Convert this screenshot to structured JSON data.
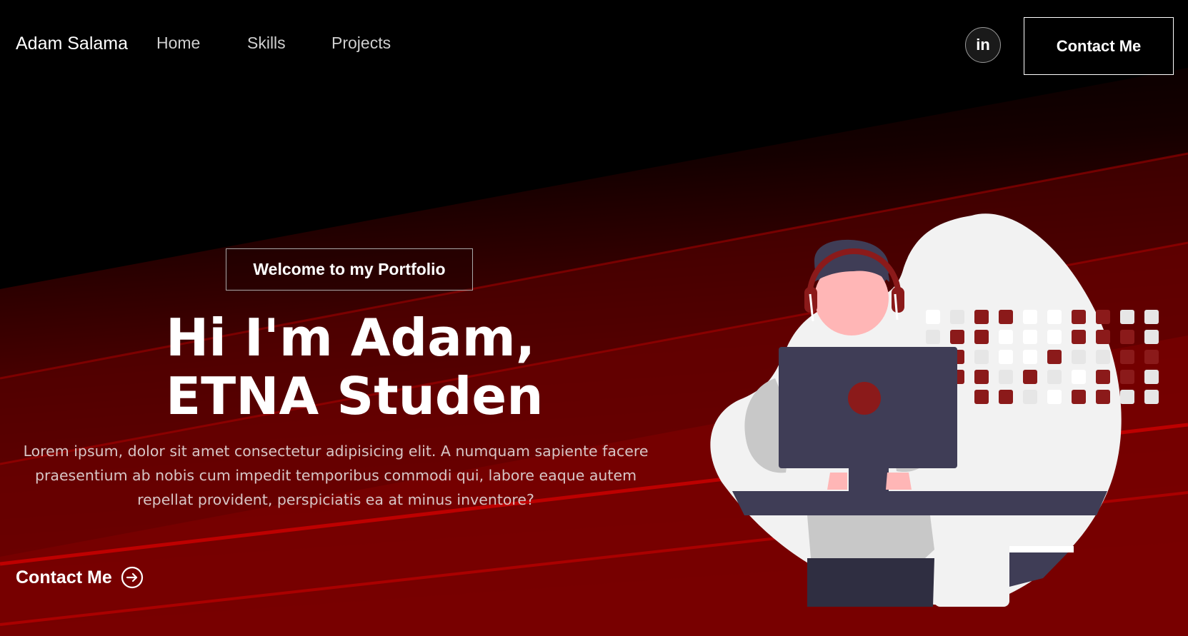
{
  "nav": {
    "brand": "Adam Salama",
    "links": [
      "Home",
      "Skills",
      "Projects"
    ],
    "social_icon_label": "in",
    "contact_label": "Contact Me"
  },
  "hero": {
    "tagline": "Welcome to my Portfolio",
    "title_line1": "Hi I'm Adam,",
    "title_line2": "ETNA Studen",
    "description": "Lorem ipsum, dolor sit amet consectetur adipisicing elit. A numquam sapiente facere praesentium ab nobis cum impedit temporibus commodi qui, labore eaque autem repellat provident, perspiciatis ea at minus inventore?",
    "cta_label": "Contact Me"
  },
  "icons": {
    "social": "linkedin-icon",
    "cta": "arrow-right-circle-icon",
    "illustration": "developer-at-computer-illustration"
  },
  "colors": {
    "background": "#000000",
    "accent_red": "#8b0000",
    "stripe_red": "#c40000",
    "blob": "#f2f2f2",
    "laptop": "#3f3d56"
  }
}
